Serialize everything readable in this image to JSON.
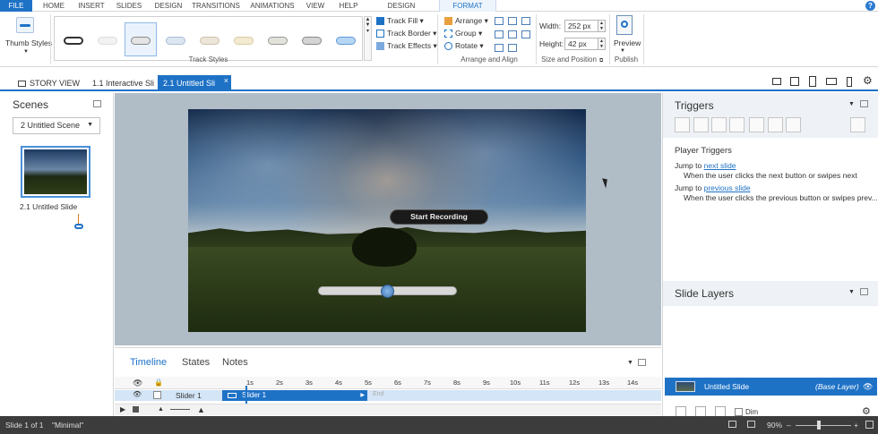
{
  "ribbon_tabs": [
    "FILE",
    "HOME",
    "INSERT",
    "SLIDES",
    "DESIGN",
    "TRANSITIONS",
    "ANIMATIONS",
    "VIEW",
    "HELP",
    "DESIGN",
    "FORMAT"
  ],
  "ribbon": {
    "thumb_styles_label": "Thumb Styles",
    "track_styles_label": "Track Styles",
    "track_fill": "Track Fill",
    "track_border": "Track Border",
    "track_effects": "Track Effects",
    "arrange": "Arrange",
    "group": "Group",
    "rotate": "Rotate",
    "arrange_align_label": "Arrange and Align",
    "width_label": "Width:",
    "width_value": "252 px",
    "height_label": "Height:",
    "height_value": "42 px",
    "size_position_label": "Size and Position",
    "preview": "Preview",
    "publish": "Publish"
  },
  "doc_tabs": {
    "story_view": "STORY VIEW",
    "tab1": "1.1 Interactive Sli",
    "tab2": "2.1 Untitled Sli"
  },
  "scenes": {
    "title": "Scenes",
    "selected_scene": "2 Untitled Scene",
    "slide_caption": "2.1 Untitled Slide"
  },
  "slide": {
    "record_button": "Start Recording"
  },
  "timeline": {
    "tabs": [
      "Timeline",
      "States",
      "Notes"
    ],
    "ticks": [
      "1s",
      "2s",
      "3s",
      "4s",
      "5s",
      "6s",
      "7s",
      "8s",
      "9s",
      "10s",
      "11s",
      "12s",
      "13s",
      "14s"
    ],
    "row_label": "Slider 1",
    "bar_label": "Slider 1",
    "end_label": "End"
  },
  "triggers": {
    "title": "Triggers",
    "section": "Player Triggers",
    "t1_prefix": "Jump to ",
    "t1_link": "next slide",
    "t1_desc": "When the user clicks the next button or swipes next",
    "t2_prefix": "Jump to ",
    "t2_link": "previous slide",
    "t2_desc": "When the user clicks the previous button or swipes prev..."
  },
  "layers": {
    "title": "Slide Layers",
    "base_name": "Untitled Slide",
    "base_tag": "(Base Layer)",
    "dim_label": "Dim"
  },
  "status": {
    "slide_count": "Slide 1 of 1",
    "theme": "\"Minimal\"",
    "zoom": "90%"
  }
}
